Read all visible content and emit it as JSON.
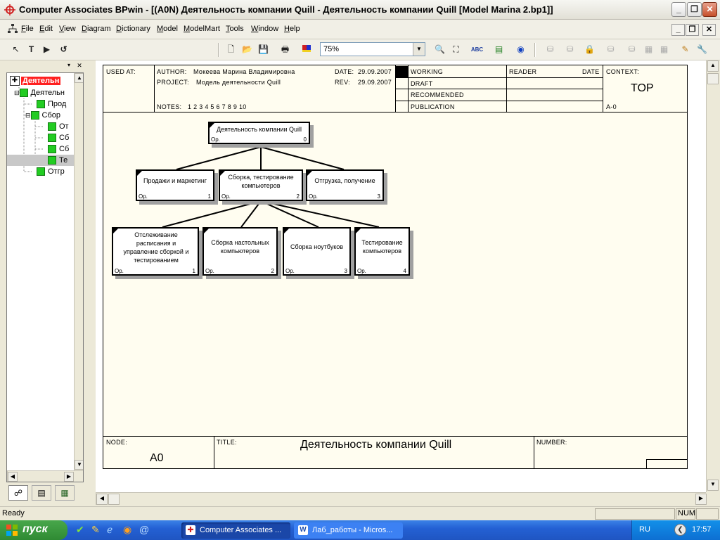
{
  "window": {
    "title": "Computer Associates BPwin - [(A0N) Деятельность компании Quill - Деятельность компании Quill  [Model Marina 2.bp1]]"
  },
  "menu": [
    "File",
    "Edit",
    "View",
    "Diagram",
    "Dictionary",
    "Model",
    "ModelMart",
    "Tools",
    "Window",
    "Help"
  ],
  "toolbar": {
    "zoom": "75%"
  },
  "tree": {
    "root": "Деятельн",
    "items": [
      "Деятельн",
      "Прод",
      "Сбор",
      "От",
      "Сб",
      "Сб",
      "Те",
      "Отгр"
    ]
  },
  "frame": {
    "used_at_label": "USED AT:",
    "author_label": "AUTHOR:",
    "author": "Мокеева Марина Владимировна",
    "project_label": "PROJECT:",
    "project": "Модель деятельности Quill",
    "date_label": "DATE:",
    "date": "29.09.2007",
    "rev_label": "REV:",
    "rev": "29.09.2007",
    "notes_label": "NOTES:",
    "notes": "1  2  3  4  5  6  7  8  9  10",
    "status": [
      "WORKING",
      "DRAFT",
      "RECOMMENDED",
      "PUBLICATION"
    ],
    "reader_label": "READER",
    "date_col_label": "DATE",
    "context_label": "CONTEXT:",
    "context": "TOP",
    "context_node": "A-0",
    "node_label": "NODE:",
    "node": "A0",
    "title_label": "TITLE:",
    "title": "Деятельность компании Quill",
    "number_label": "NUMBER:"
  },
  "diagram": {
    "op": "Ор.",
    "root": {
      "label": "Деятельность компании Quill",
      "num": "0"
    },
    "level1": [
      {
        "label": "Продажи и маркетинг",
        "num": "1"
      },
      {
        "label": "Сборка, тестирование компьютеров",
        "num": "2"
      },
      {
        "label": "Отгрузка, получение",
        "num": "3"
      }
    ],
    "level2": [
      {
        "label": "Отслеживание расписания и управление сборкой и тестированием",
        "num": "1"
      },
      {
        "label": "Сборка настольных компьютеров",
        "num": "2"
      },
      {
        "label": "Сборка ноутбуков",
        "num": "3"
      },
      {
        "label": "Тестирование компьютеров",
        "num": "4"
      }
    ]
  },
  "status": {
    "ready": "Ready",
    "num": "NUM"
  },
  "taskbar": {
    "start": "пуск",
    "tasks": [
      "Computer Associates ...",
      "Лаб_работы - Micros..."
    ],
    "lang": "RU",
    "clock": "17:57"
  }
}
